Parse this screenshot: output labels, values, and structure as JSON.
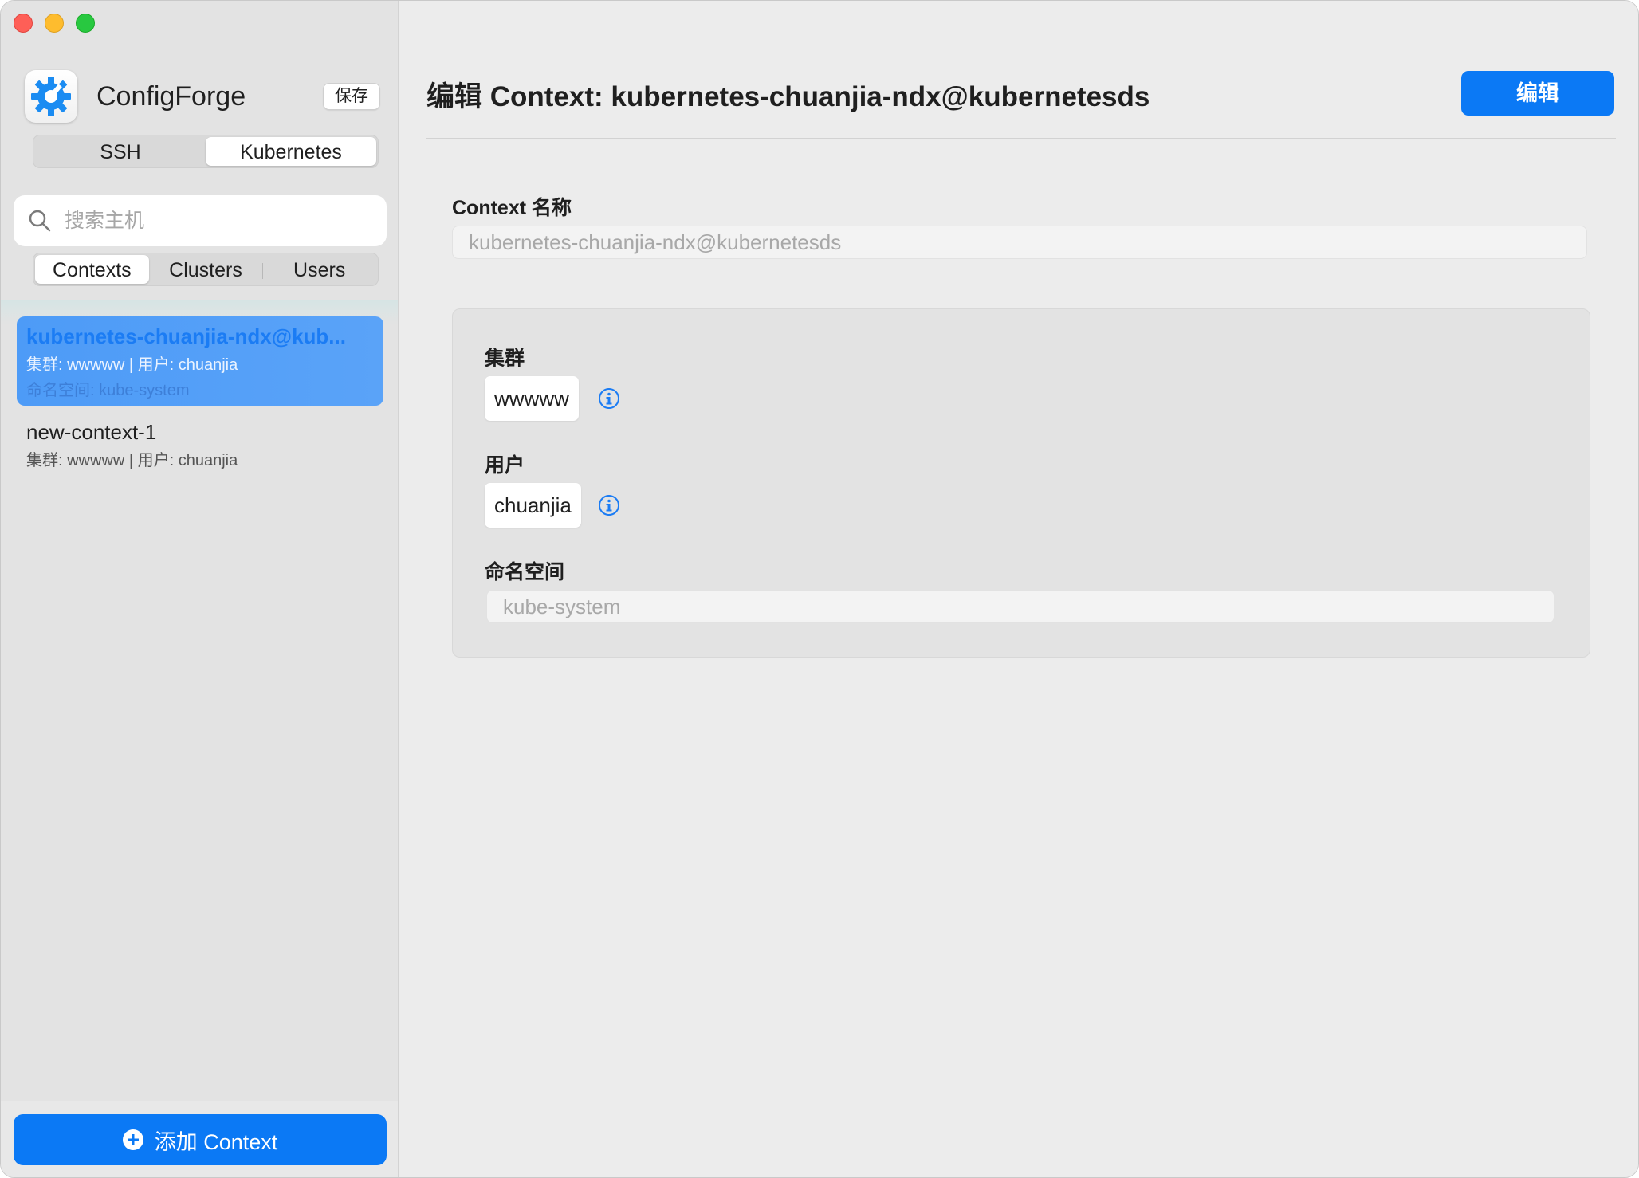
{
  "app": {
    "name": "ConfigForge",
    "save_label": "保存"
  },
  "top_tabs": [
    "SSH",
    "Kubernetes"
  ],
  "top_tabs_active": "Kubernetes",
  "search": {
    "placeholder": "搜索主机",
    "value": ""
  },
  "sub_tabs": [
    "Contexts",
    "Clusters",
    "Users"
  ],
  "sub_tabs_active": "Contexts",
  "contexts": [
    {
      "title": "kubernetes-chuanjia-ndx@kub...",
      "subtitle": "集群: wwwww | 用户: chuanjia",
      "namespace": "命名空间: kube-system",
      "selected": true
    },
    {
      "title": "new-context-1",
      "subtitle": "集群: wwwww | 用户: chuanjia",
      "selected": false
    }
  ],
  "add_button_label": "添加 Context",
  "main": {
    "title": "编辑 Context: kubernetes-chuanjia-ndx@kubernetesds",
    "edit_label": "编辑",
    "context_name_label": "Context 名称",
    "context_name_value": "kubernetes-chuanjia-ndx@kubernetesds",
    "cluster_label": "集群",
    "cluster_value": "wwwww",
    "user_label": "用户",
    "user_value": "chuanjia",
    "namespace_label": "命名空间",
    "namespace_placeholder": "kube-system"
  },
  "colors": {
    "accent": "#0b79f5",
    "selection": "#4d9bf7",
    "close": "#fe5f57",
    "minimize": "#febc2e",
    "maximize": "#28c840"
  }
}
